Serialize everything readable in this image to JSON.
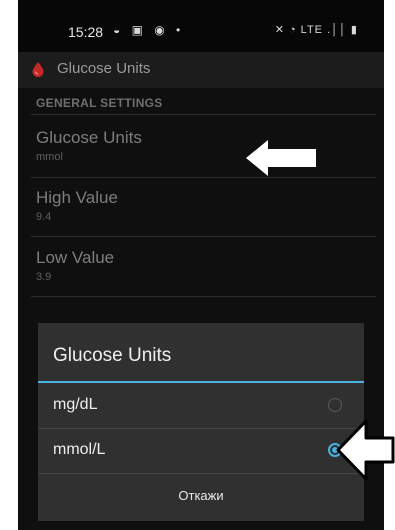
{
  "status_bar": {
    "time": "15:28",
    "notification_icons": "◒ ▣ ◉ •",
    "right_icons": "✕ ◔ LTE .││ ▮"
  },
  "app_bar": {
    "title": "Glucose Units",
    "icon": "blood-drop-icon",
    "icon_color": "#c62828"
  },
  "settings": {
    "section_header": "GENERAL SETTINGS",
    "items": [
      {
        "title": "Glucose Units",
        "summary": "mmol"
      },
      {
        "title": "High Value",
        "summary": "9.4"
      },
      {
        "title": "Low Value",
        "summary": "3.9"
      }
    ]
  },
  "dialog": {
    "title": "Glucose Units",
    "accent_color": "#4ab3e0",
    "options": [
      {
        "label": "mg/dL",
        "selected": false
      },
      {
        "label": "mmol/L",
        "selected": true
      }
    ],
    "cancel_label": "Откажи"
  },
  "annotations": {
    "arrow_color": "#ffffff"
  }
}
